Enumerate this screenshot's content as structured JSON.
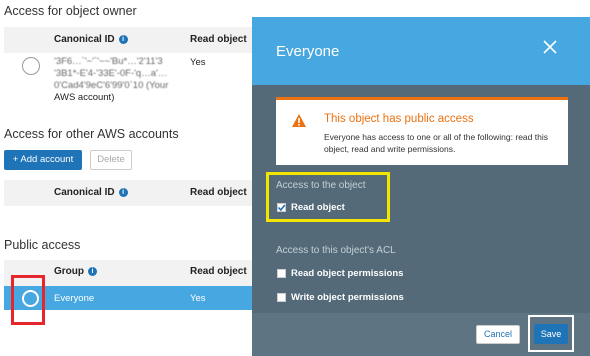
{
  "owner": {
    "title": "Access for object owner",
    "col_canonical": "Canonical ID",
    "col_read": "Read object",
    "id_lines": [
      "'3F6…`'~'`'~~'Bu*…'2'11'3",
      "'3B1*-E'4-'33E'-0F-'q…a'…",
      "0'Cad4'9eC'6'99'0`10 (Your"
    ],
    "account_label": "AWS account)",
    "read_value": "Yes"
  },
  "other": {
    "title": "Access for other AWS accounts",
    "add_button": "+ Add account",
    "delete_button": "Delete",
    "col_canonical": "Canonical ID",
    "col_read": "Read object"
  },
  "public": {
    "title": "Public access",
    "col_group": "Group",
    "col_read": "Read object",
    "row_group": "Everyone",
    "row_read": "Yes"
  },
  "modal": {
    "title": "Everyone",
    "alert_title": "This object has public access",
    "alert_text": "Everyone has access to one or all of the following: read this object, read and write permissions.",
    "section_object": "Access to the object",
    "read_object": "Read object",
    "section_acl": "Access to this object's ACL",
    "read_permissions": "Read object permissions",
    "write_permissions": "Write object permissions",
    "cancel": "Cancel",
    "save": "Save"
  },
  "colors": {
    "accent": "#1f73b7",
    "modal_header": "#47a7e0",
    "modal_body": "#546a78",
    "warning": "#ec7211",
    "highlight_yellow": "#f2e600",
    "highlight_red": "#e5262b"
  }
}
